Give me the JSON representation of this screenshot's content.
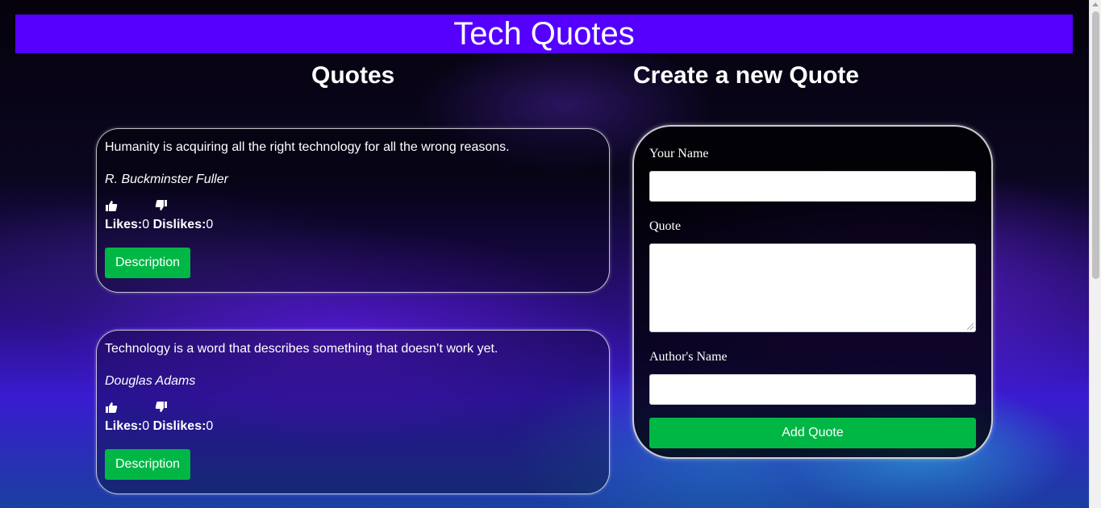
{
  "header": {
    "title": "Tech Quotes"
  },
  "quotes_section": {
    "title": "Quotes",
    "quotes": [
      {
        "text": "Humanity is acquiring all the right technology for all the wrong reasons.",
        "author": "R. Buckminster Fuller",
        "likes_label": "Likes:",
        "likes": "0",
        "dislikes_label": "Dislikes:",
        "dislikes": "0",
        "description_label": "Description"
      },
      {
        "text": "Technology is a word that describes something that doesn’t work yet.",
        "author": "Douglas Adams",
        "likes_label": "Likes:",
        "likes": "0",
        "dislikes_label": "Dislikes:",
        "dislikes": "0",
        "description_label": "Description"
      }
    ]
  },
  "form": {
    "title": "Create a new Quote",
    "name_label": "Your Name",
    "name_value": "",
    "quote_label": "Quote",
    "quote_value": "",
    "author_label": "Author's Name",
    "author_value": "",
    "submit_label": "Add Quote"
  },
  "icons": {
    "like": "thumbs-up-icon",
    "dislike": "thumbs-down-icon"
  },
  "colors": {
    "header_bg": "#5500ff",
    "button_green": "#00b746"
  }
}
